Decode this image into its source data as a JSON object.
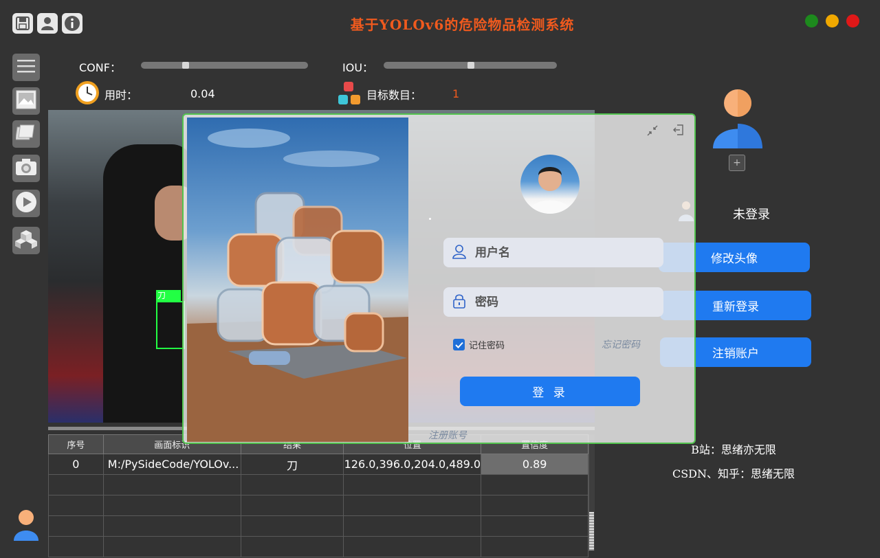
{
  "app": {
    "title": "基于YOLOv6的危险物品检测系统",
    "window_controls": {
      "max_color": "#1d8a1d",
      "min_color": "#f0a800",
      "close_color": "#e01818"
    }
  },
  "params": {
    "conf_label": "CONF：",
    "conf_value": 0.25,
    "iou_label": "IOU：",
    "iou_value": 0.5,
    "time_label": "用时：",
    "time_value": "0.04",
    "count_label": "目标数目：",
    "count_value": "1"
  },
  "detection": {
    "label": "刀"
  },
  "table": {
    "headers": [
      "序号",
      "画面标识",
      "结果",
      "位置",
      "置信度"
    ],
    "rows": [
      [
        "0",
        "M:/PySideCode/YOLOv...",
        "刀",
        "126.0,396.0,204.0,489.0",
        "0.89"
      ],
      [
        "",
        "",
        "",
        "",
        ""
      ],
      [
        "",
        "",
        "",
        "",
        ""
      ],
      [
        "",
        "",
        "",
        "",
        ""
      ],
      [
        "",
        "",
        "",
        "",
        ""
      ]
    ]
  },
  "right_panel": {
    "status": "未登录",
    "btn_avatar": "修改头像",
    "btn_relogin": "重新登录",
    "btn_logout": "注销账户",
    "footer_bili": "B站：思绪亦无限",
    "footer_csdn": "CSDN、知乎：思绪无限"
  },
  "login": {
    "username_placeholder": "用户名",
    "password_placeholder": "密码",
    "remember_label": "记住密码",
    "remember_checked": true,
    "forgot_label": "忘记密码",
    "login_button": "登 录",
    "register_label": "注册账号"
  },
  "colors": {
    "accent": "#1f7af0",
    "title": "#f05a1e",
    "detect": "#22ff44"
  }
}
